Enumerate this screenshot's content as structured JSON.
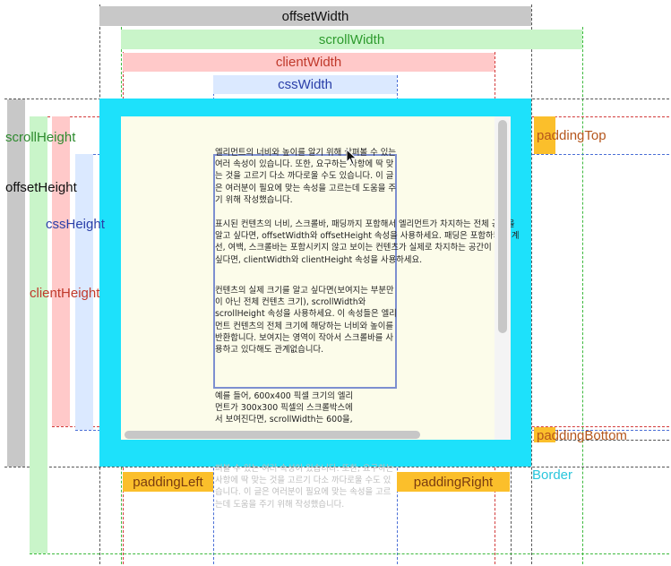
{
  "labels": {
    "offsetWidth": "offsetWidth",
    "scrollWidth": "scrollWidth",
    "clientWidth": "clientWidth",
    "cssWidth": "cssWidth",
    "scrollHeight": "scrollHeight",
    "offsetHeight": "offsetHeight",
    "cssHeight": "cssHeight",
    "clientHeight": "clientHeight",
    "paddingTop": "paddingTop",
    "paddingBottom": "paddingBottom",
    "paddingLeft": "paddingLeft",
    "paddingRight": "paddingRight",
    "border": "Border"
  },
  "content": {
    "para1": "엘리먼트의 너비와 높이를 알기 위해 살펴볼 수 있는 여러 속성이 있습니다. 또한, 요구하는 사항에 딱 맞는 것을 고르기 다소 까다로울 수도 있습니다. 이 글은 여러분이 필요에 맞는 속성을 고르는데 도움을 주기 위해 작성했습니다.",
    "para2_line1": "표시된 컨텐츠의 너비, 스크롤바, 패딩까지 포함해서 엘리먼트가 차지하는 전체 공간을",
    "para2_line2": "알고 싶다면, offsetWidth와 offsetHeight 속성을 사용하세요. 패딩은 포함하되 경계",
    "para2_line3": "선, 여백, 스크롤바는 포함시키지 않고 보이는 컨텐츠가 실제로 차지하는 공간이 알고",
    "para2_line4": "싶다면, clientWidth와 clientHeight 속성을 사용하세요.",
    "para3": "컨텐츠의 실제 크기를 알고 싶다면(보여지는 부분만이 아닌 전체 컨텐츠 크기), scrollWidth와 scrollHeight 속성을 사용하세요. 이 속성들은 엘리먼트 컨텐츠의 전체 크기에 해당하는 너비와 높이를 반환합니다. 보여지는 영역이 작아서 스크롤바를 사용하고 있다해도 관계없습니다.",
    "para4_line1": "예를 들어, 600x400 픽셀 크기의 엘리",
    "para4_line2": "먼트가 300x300 픽셀의 스크롤박스에",
    "para4_line3": "서 보여진다면, scrollWidth는 600을,",
    "ghost": "펴볼 수 있는 여러 속성이 있습니다. 또한, 요구하는 사항에 딱 맞는 것을 고르기 다소 까다로울 수도 있습니다. 이 글은 여러분이 필요에 맞는 속성을 고르는데 도움을 주기 위해 작성했습니다."
  },
  "colors": {
    "offset": "#c8c8c8",
    "scroll": "#c9f5c9",
    "client": "#ffc9c9",
    "css": "#dbe9ff",
    "border": "#1de1fb",
    "padding": "#fcfcea",
    "paddingLabel": "#fbbf2b",
    "scrollbar": "#c7c7c7"
  }
}
